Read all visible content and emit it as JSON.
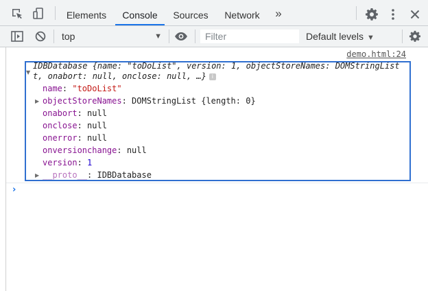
{
  "tabs": [
    {
      "label": "Elements",
      "active": false
    },
    {
      "label": "Console",
      "active": true
    },
    {
      "label": "Sources",
      "active": false
    },
    {
      "label": "Network",
      "active": false
    }
  ],
  "more_tabs_glyph": "»",
  "toolbar": {
    "context_value": "top",
    "dropdown_arrow": "▼",
    "filter_placeholder": "Filter",
    "levels_label": "Default levels"
  },
  "output": {
    "source_link": "demo.html:24",
    "summary_line1": "IDBDatabase {name: \"toDoList\", version: 1, objectStoreNames: DOMStringList",
    "summary_line2": "t, onabort: null, onclose: null, …}",
    "info_badge": "i",
    "properties": [
      {
        "key": "name",
        "value": "\"toDoList\"",
        "kind": "str",
        "expandable": false
      },
      {
        "key": "objectStoreNames",
        "value": "DOMStringList {length: 0}",
        "kind": "obj",
        "expandable": true
      },
      {
        "key": "onabort",
        "value": "null",
        "kind": "plain",
        "expandable": false
      },
      {
        "key": "onclose",
        "value": "null",
        "kind": "plain",
        "expandable": false
      },
      {
        "key": "onerror",
        "value": "null",
        "kind": "plain",
        "expandable": false
      },
      {
        "key": "onversionchange",
        "value": "null",
        "kind": "plain",
        "expandable": false
      },
      {
        "key": "version",
        "value": "1",
        "kind": "num",
        "expandable": false
      },
      {
        "key": "__proto__",
        "value": "IDBDatabase",
        "kind": "plain",
        "expandable": true
      }
    ],
    "prompt_glyph": "›"
  },
  "icons": [
    "inspect-element-icon",
    "device-toolbar-icon",
    "more-tabs-icon",
    "settings-gear-icon",
    "kebab-menu-icon",
    "close-icon",
    "sidebar-toggle-icon",
    "clear-console-icon",
    "eye-icon",
    "console-settings-icon"
  ],
  "colors": {
    "accent": "#1a73e8",
    "highlight_box": "#2f6fd0",
    "property_key": "#881391",
    "string_value": "#c41a16",
    "number_value": "#1c00cf",
    "toolbar_bg": "#f1f3f4"
  }
}
